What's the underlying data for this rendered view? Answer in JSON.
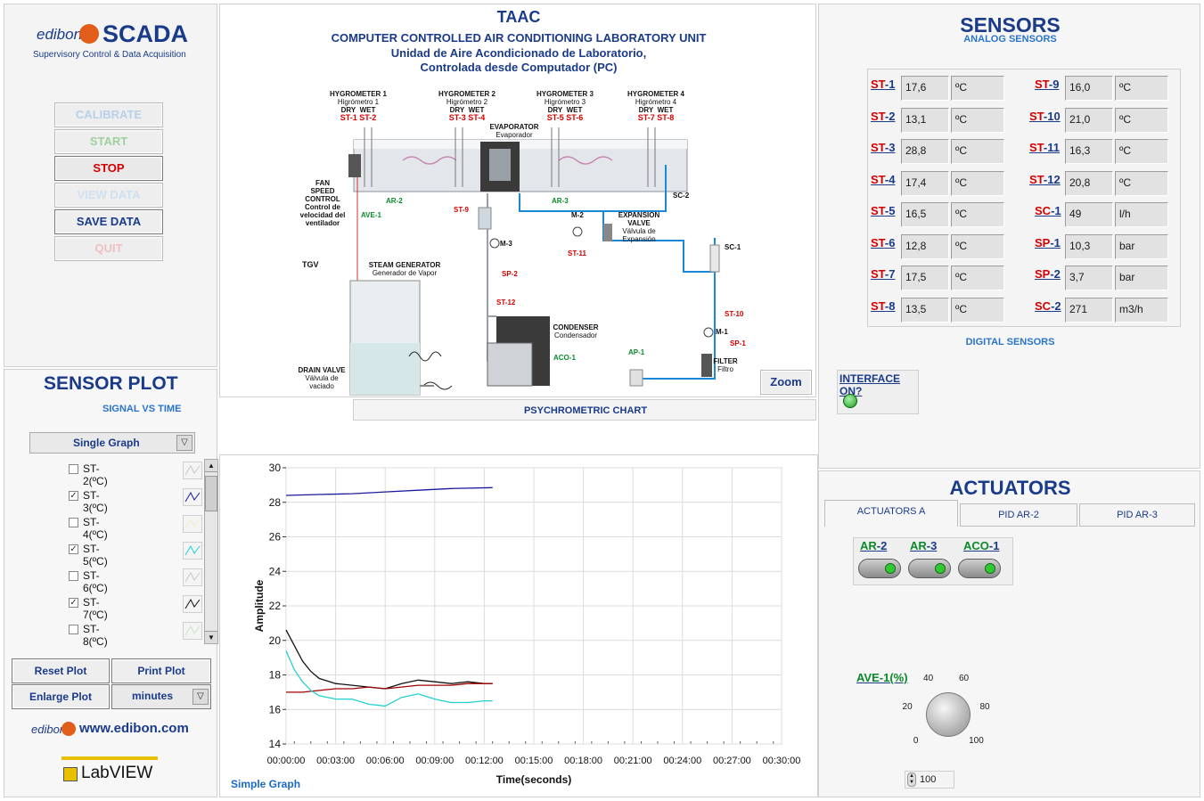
{
  "logo": {
    "brand": "edibon",
    "product": "SCADA",
    "subtitle": "Supervisory Control & Data Acquisition"
  },
  "controls": {
    "calibrate": "CALIBRATE",
    "start": "START",
    "stop": "STOP",
    "view_data": "VIEW DATA",
    "save_data": "SAVE DATA",
    "quit": "QUIT"
  },
  "header": {
    "code": "TAAC",
    "title_en": "COMPUTER CONTROLLED AIR CONDITIONING LABORATORY UNIT",
    "title_es_1": "Unidad de Aire Acondicionado de Laboratorio,",
    "title_es_2": "Controlada desde Computador (PC)"
  },
  "diagram": {
    "hygrometers": [
      {
        "title": "HYGROMETER 1",
        "sub": "Higrómetro 1",
        "dry": "ST-1",
        "wet": "ST-2"
      },
      {
        "title": "HYGROMETER 2",
        "sub": "Higrómetro 2",
        "dry": "ST-3",
        "wet": "ST-4"
      },
      {
        "title": "HYGROMETER 3",
        "sub": "Higrómetro 3",
        "dry": "ST-5",
        "wet": "ST-6"
      },
      {
        "title": "HYGROMETER 4",
        "sub": "Higrómetro 4",
        "dry": "ST-7",
        "wet": "ST-8"
      }
    ],
    "dry": "DRY",
    "wet": "WET",
    "evaporator": "EVAPORATOR",
    "evaporator_es": "Evaporador",
    "fan_1": "FAN",
    "fan_2": "SPEED CONTROL",
    "fan_3": "Control de",
    "fan_4": "velocidad del",
    "fan_5": "ventilador",
    "ave1": "AVE-1",
    "ar2": "AR-2",
    "ar3": "AR-3",
    "st9": "ST-9",
    "sc2": "SC-2",
    "m2": "M-2",
    "exp_1": "EXPANSION",
    "exp_2": "VALVE",
    "exp_3": "Válvula de",
    "exp_4": "Expansión",
    "m3": "M-3",
    "st11": "ST-11",
    "sc1": "SC-1",
    "tgv": "TGV",
    "steam_1": "STEAM GENERATOR",
    "steam_2": "Generador de Vapor",
    "sp2": "SP-2",
    "st12": "ST-12",
    "condenser_1": "CONDENSER",
    "condenser_2": "Condensador",
    "aco1": "ACO-1",
    "ap1": "AP-1",
    "st10": "ST-10",
    "m1": "M-1",
    "sp1": "SP-1",
    "filter_1": "FILTER",
    "filter_2": "Filtro",
    "drain_1": "DRAIN VALVE",
    "drain_2": "Válvula de",
    "drain_3": "vaciado",
    "zoom": "Zoom"
  },
  "sensors": {
    "title": "SENSORS",
    "subtitle": "ANALOG SENSORS",
    "digital": "DIGITAL SENSORS",
    "left": [
      {
        "p": "ST",
        "n": "-1",
        "value": "17,6",
        "unit": "ºC"
      },
      {
        "p": "ST",
        "n": "-2",
        "value": "13,1",
        "unit": "ºC"
      },
      {
        "p": "ST",
        "n": "-3",
        "value": "28,8",
        "unit": "ºC"
      },
      {
        "p": "ST",
        "n": "-4",
        "value": "17,4",
        "unit": "ºC"
      },
      {
        "p": "ST",
        "n": "-5",
        "value": "16,5",
        "unit": "ºC"
      },
      {
        "p": "ST",
        "n": "-6",
        "value": "12,8",
        "unit": "ºC"
      },
      {
        "p": "ST",
        "n": "-7",
        "value": "17,5",
        "unit": "ºC"
      },
      {
        "p": "ST",
        "n": "-8",
        "value": "13,5",
        "unit": "ºC"
      }
    ],
    "right": [
      {
        "p": "ST",
        "n": "-9",
        "value": "16,0",
        "unit": "ºC"
      },
      {
        "p": "ST",
        "n": "-10",
        "value": "21,0",
        "unit": "ºC"
      },
      {
        "p": "ST",
        "n": "-11",
        "value": "16,3",
        "unit": "ºC"
      },
      {
        "p": "ST",
        "n": "-12",
        "value": "20,8",
        "unit": "ºC"
      },
      {
        "p": "SC",
        "n": "-1",
        "value": "49",
        "unit": "l/h"
      },
      {
        "p": "SP",
        "n": "-1",
        "value": "10,3",
        "unit": "bar"
      },
      {
        "p": "SP",
        "n": "-2",
        "value": "3,7",
        "unit": "bar"
      },
      {
        "p": "SC",
        "n": "-2",
        "value": "271",
        "unit": "m3/h"
      }
    ],
    "interface": "INTERFACE ON?"
  },
  "actuators": {
    "title": "ACTUATORS",
    "tabs": [
      "ACTUATORS A",
      "PID AR-2",
      "PID AR-3"
    ],
    "switches": [
      {
        "p": "AR",
        "n": "-2"
      },
      {
        "p": "AR",
        "n": "-3"
      },
      {
        "p": "ACO",
        "n": "-1"
      }
    ],
    "ave_label": "AVE-1(%)",
    "dial_ticks": [
      "0",
      "20",
      "40",
      "60",
      "80",
      "100"
    ],
    "dial_value": "100"
  },
  "plot": {
    "title": "SENSOR PLOT",
    "subtitle": "SIGNAL VS TIME",
    "psy": "PSYCHROMETRIC CHART",
    "mode": "Single Graph",
    "items": [
      {
        "label": "ST-2(ºC)",
        "checked": false,
        "color": "#c8c8c8"
      },
      {
        "label": "ST-3(ºC)",
        "checked": true,
        "color": "#1a1aa0"
      },
      {
        "label": "ST-4(ºC)",
        "checked": false,
        "color": "#f0f0c8"
      },
      {
        "label": "ST-5(ºC)",
        "checked": true,
        "color": "#22d0d0"
      },
      {
        "label": "ST-6(ºC)",
        "checked": false,
        "color": "#c8c8c8"
      },
      {
        "label": "ST-7(ºC)",
        "checked": true,
        "color": "#111111"
      },
      {
        "label": "ST-8(ºC)",
        "checked": false,
        "color": "#c8e8c8"
      }
    ],
    "reset": "Reset Plot",
    "print": "Print Plot",
    "enlarge": "Enlarge Plot",
    "units": "minutes",
    "graph_label": "Simple Graph"
  },
  "footer": {
    "brand": "edibon",
    "url": "www.edibon.com",
    "labview": "LabVIEW"
  },
  "chart_data": {
    "type": "line",
    "xlabel": "Time(seconds)",
    "ylabel": "Amplitude",
    "ylim": [
      14,
      30
    ],
    "xticks": [
      "00:00:00",
      "00:03:00",
      "00:06:00",
      "00:09:00",
      "00:12:00",
      "00:15:00",
      "00:18:00",
      "00:21:00",
      "00:24:00",
      "00:27:00",
      "00:30:00"
    ],
    "yticks": [
      14,
      16,
      18,
      20,
      22,
      24,
      26,
      28,
      30
    ],
    "grid": true,
    "series": [
      {
        "color": "#1a1aa0",
        "x": [
          0,
          2,
          4,
          6,
          8,
          10,
          12.5
        ],
        "y": [
          28.4,
          28.45,
          28.5,
          28.6,
          28.7,
          28.8,
          28.85
        ]
      },
      {
        "color": "#111111",
        "x": [
          0,
          0.5,
          1,
          1.5,
          2,
          3,
          4,
          5,
          6,
          7,
          8,
          9,
          10,
          11,
          12,
          12.5
        ],
        "y": [
          20.6,
          19.7,
          18.8,
          18.2,
          17.8,
          17.5,
          17.4,
          17.3,
          17.2,
          17.5,
          17.7,
          17.6,
          17.5,
          17.6,
          17.5,
          17.5
        ]
      },
      {
        "color": "#a00000",
        "x": [
          0,
          1,
          2,
          3,
          4,
          5,
          6,
          7,
          8,
          9,
          10,
          11,
          12,
          12.5
        ],
        "y": [
          17.0,
          17.0,
          17.1,
          17.2,
          17.2,
          17.3,
          17.2,
          17.3,
          17.4,
          17.4,
          17.4,
          17.5,
          17.5,
          17.5
        ]
      },
      {
        "color": "#22d0d0",
        "x": [
          0,
          0.5,
          1,
          1.5,
          2,
          3,
          4,
          5,
          6,
          7,
          8,
          9,
          10,
          11,
          12,
          12.5
        ],
        "y": [
          19.4,
          18.3,
          17.6,
          17.1,
          16.8,
          16.6,
          16.6,
          16.3,
          16.2,
          16.7,
          16.9,
          16.6,
          16.4,
          16.4,
          16.5,
          16.5
        ]
      }
    ]
  }
}
